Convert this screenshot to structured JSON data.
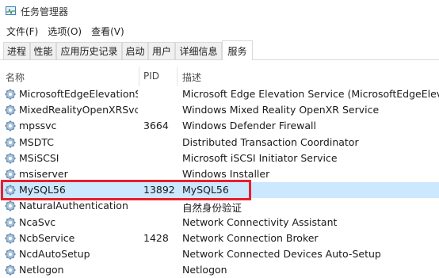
{
  "window": {
    "title": "任务管理器"
  },
  "menu": [
    "文件(F)",
    "选项(O)",
    "查看(V)"
  ],
  "tabs": [
    {
      "label": "进程",
      "active": false
    },
    {
      "label": "性能",
      "active": false
    },
    {
      "label": "应用历史记录",
      "active": false
    },
    {
      "label": "启动",
      "active": false
    },
    {
      "label": "用户",
      "active": false
    },
    {
      "label": "详细信息",
      "active": false
    },
    {
      "label": "服务",
      "active": true
    }
  ],
  "columns": {
    "name": "名称",
    "pid": "PID",
    "desc": "描述"
  },
  "services": [
    {
      "name": "MicrosoftEdgeElevationS...",
      "pid": "",
      "desc": "Microsoft Edge Elevation Service (MicrosoftEdgeElevationService)",
      "selected": false
    },
    {
      "name": "MixedRealityOpenXRSvc",
      "pid": "",
      "desc": "Windows Mixed Reality OpenXR Service",
      "selected": false
    },
    {
      "name": "mpssvc",
      "pid": "3664",
      "desc": "Windows Defender Firewall",
      "selected": false
    },
    {
      "name": "MSDTC",
      "pid": "",
      "desc": "Distributed Transaction Coordinator",
      "selected": false
    },
    {
      "name": "MSiSCSI",
      "pid": "",
      "desc": "Microsoft iSCSI Initiator Service",
      "selected": false
    },
    {
      "name": "msiserver",
      "pid": "",
      "desc": "Windows Installer",
      "selected": false
    },
    {
      "name": "MySQL56",
      "pid": "13892",
      "desc": "MySQL56",
      "selected": true
    },
    {
      "name": "NaturalAuthentication",
      "pid": "",
      "desc": "自然身份验证",
      "selected": false
    },
    {
      "name": "NcaSvc",
      "pid": "",
      "desc": "Network Connectivity Assistant",
      "selected": false
    },
    {
      "name": "NcbService",
      "pid": "1428",
      "desc": "Network Connection Broker",
      "selected": false
    },
    {
      "name": "NcdAutoSetup",
      "pid": "",
      "desc": "Network Connected Devices Auto-Setup",
      "selected": false
    },
    {
      "name": "Netlogon",
      "pid": "",
      "desc": "Netlogon",
      "selected": false
    }
  ],
  "colors": {
    "selected_row": "#cce8ff",
    "highlight_border": "#e8202a"
  }
}
